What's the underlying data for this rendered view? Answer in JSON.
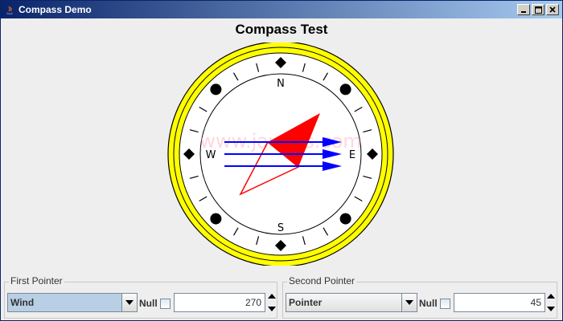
{
  "window": {
    "title": "Compass Demo",
    "icon": "java-icon"
  },
  "plot": {
    "title": "Compass Test",
    "directions": {
      "north": "N",
      "south": "S",
      "east": "E",
      "west": "W"
    },
    "watermark": "www.java2s.com",
    "colors": {
      "ring": "#ffff00",
      "face": "#ffffff",
      "first_pointer": "#ff0000",
      "second_pointer": "#0000ff"
    },
    "first_pointer_angle": 270,
    "second_pointer_angle": 45
  },
  "first_pointer": {
    "label": "First Pointer",
    "type_value": "Wind",
    "null_label": "Null",
    "null_checked": false,
    "value": "270"
  },
  "second_pointer": {
    "label": "Second Pointer",
    "type_value": "Pointer",
    "null_label": "Null",
    "null_checked": false,
    "value": "45"
  }
}
